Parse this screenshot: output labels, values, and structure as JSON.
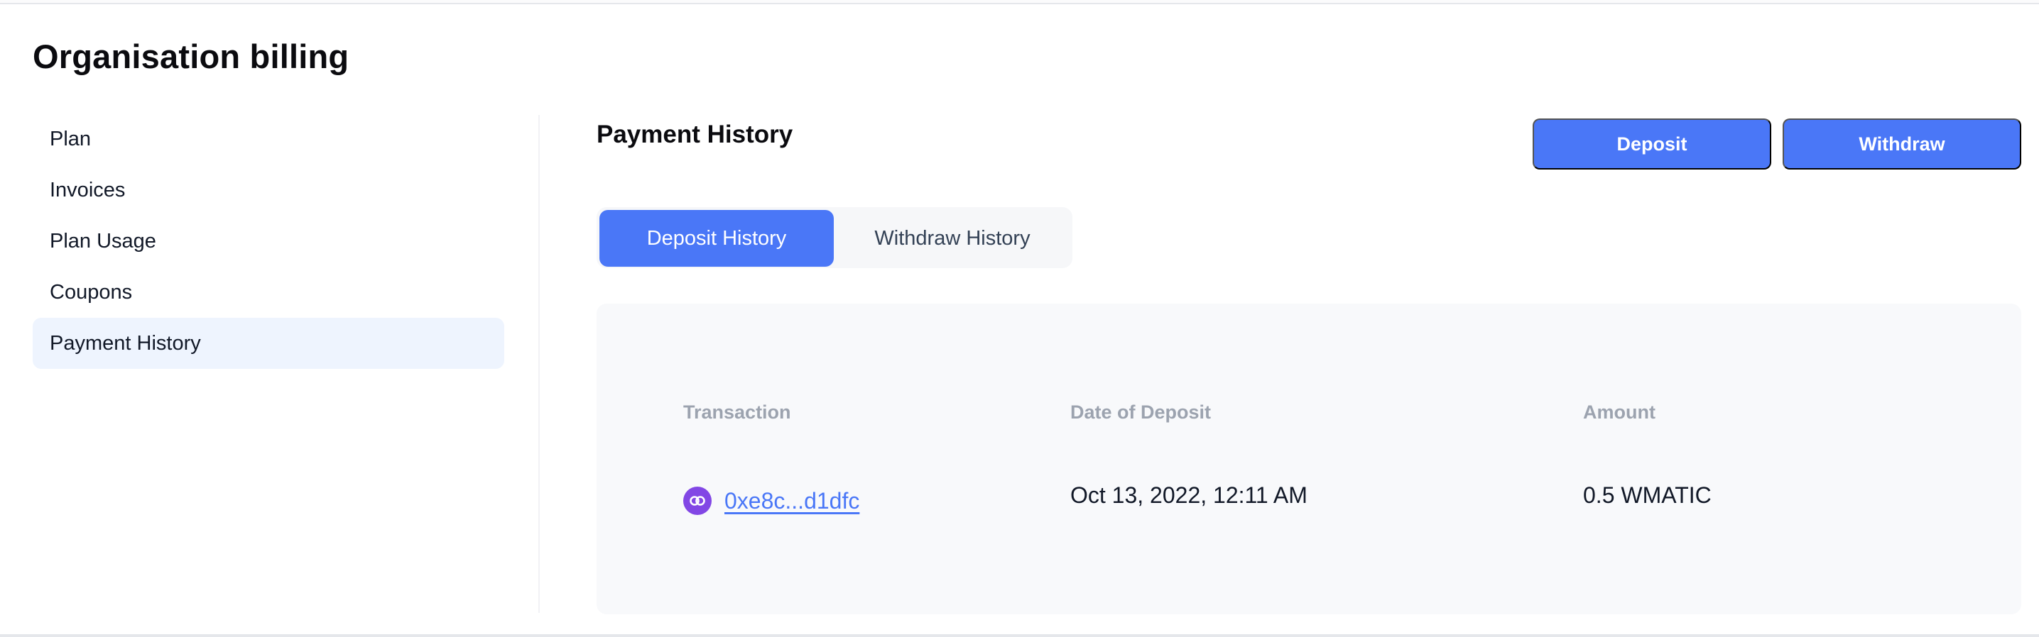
{
  "page": {
    "title": "Organisation billing"
  },
  "sidebar": {
    "items": [
      {
        "label": "Plan",
        "active": false
      },
      {
        "label": "Invoices",
        "active": false
      },
      {
        "label": "Plan Usage",
        "active": false
      },
      {
        "label": "Coupons",
        "active": false
      },
      {
        "label": "Payment History",
        "active": true
      }
    ]
  },
  "main": {
    "section_title": "Payment History",
    "actions": {
      "deposit_label": "Deposit",
      "withdraw_label": "Withdraw"
    },
    "tabs": [
      {
        "label": "Deposit History",
        "active": true
      },
      {
        "label": "Withdraw History",
        "active": false
      }
    ],
    "table": {
      "columns": [
        "Transaction",
        "Date of Deposit",
        "Amount"
      ],
      "rows": [
        {
          "chain_icon": "polygon-icon",
          "transaction": "0xe8c...d1dfc",
          "date": "Oct 13, 2022, 12:11 AM",
          "amount": "0.5 WMATIC"
        }
      ]
    }
  },
  "colors": {
    "accent": "#4a77f7",
    "active_nav_bg": "#eef4fe",
    "table_bg": "#f8f9fb",
    "header_text": "#9ca3af",
    "polygon": "#8247e5"
  }
}
